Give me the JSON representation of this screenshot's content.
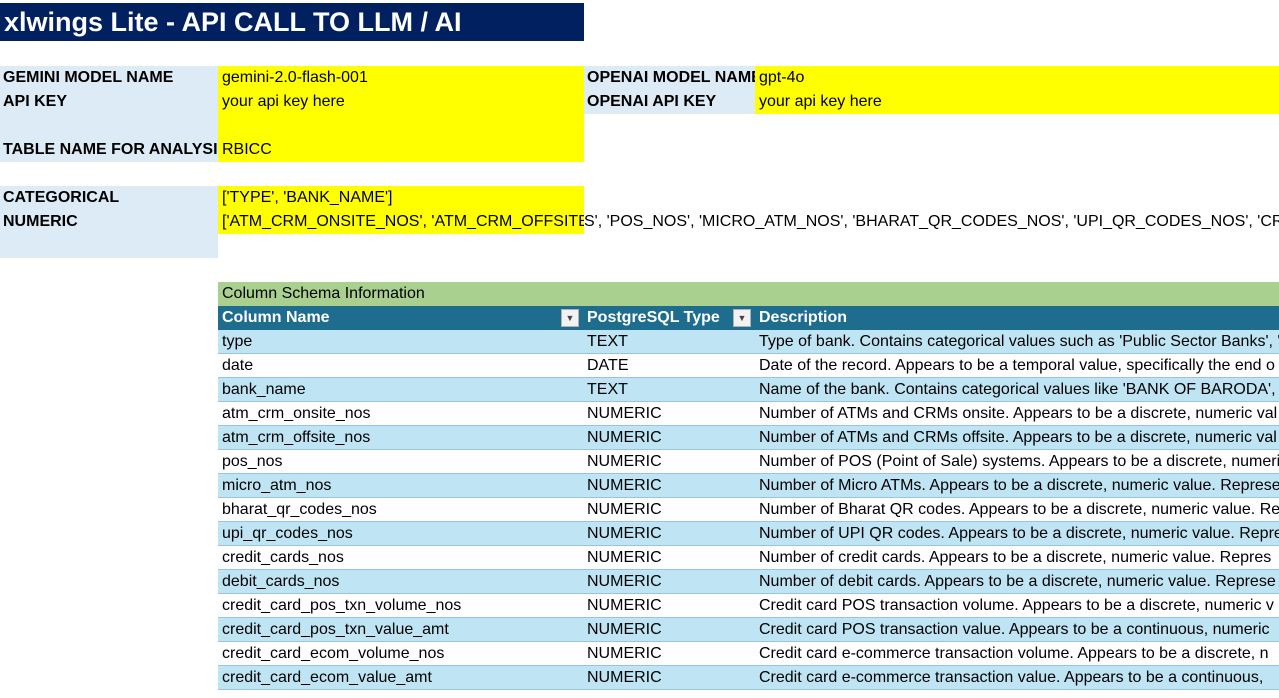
{
  "title": "xlwings Lite -  API CALL TO LLM  / AI",
  "config": {
    "gemini_model_label": "GEMINI MODEL NAME",
    "gemini_model_value": "gemini-2.0-flash-001",
    "api_key_label": "API KEY",
    "api_key_value": "your api key here",
    "openai_model_label": "OPENAI MODEL NAME",
    "openai_model_value": "gpt-4o",
    "openai_api_key_label": "OPENAI API KEY",
    "openai_api_key_value": "your api key here",
    "table_name_label": "TABLE NAME FOR ANALYSIS",
    "table_name_value": "RBICC",
    "categorical_label": "CATEGORICAL",
    "categorical_value": "['TYPE', 'BANK_NAME']",
    "numeric_label": "NUMERIC",
    "numeric_value_highlighted": "['ATM_CRM_ONSITE_NOS', 'ATM_CRM_OFFSITE_NO",
    "numeric_value_overflow": "S', 'POS_NOS', 'MICRO_ATM_NOS', 'BHARAT_QR_CODES_NOS', 'UPI_QR_CODES_NOS', 'CREDIT_C"
  },
  "schema": {
    "title": "Column Schema Information",
    "headers": [
      "Column Name",
      "PostgreSQL Type",
      "Description"
    ],
    "rows": [
      {
        "name": "type",
        "type": "TEXT",
        "desc": "Type of bank. Contains categorical values such as 'Public Sector Banks', '"
      },
      {
        "name": "date",
        "type": "DATE",
        "desc": "Date of the record. Appears to be a temporal value, specifically the end o"
      },
      {
        "name": "bank_name",
        "type": "TEXT",
        "desc": "Name of the bank. Contains categorical values like 'BANK OF BARODA', 'B"
      },
      {
        "name": "atm_crm_onsite_nos",
        "type": "NUMERIC",
        "desc": "Number of ATMs and CRMs onsite. Appears to be a discrete, numeric val"
      },
      {
        "name": "atm_crm_offsite_nos",
        "type": "NUMERIC",
        "desc": "Number of ATMs and CRMs offsite. Appears to be a discrete, numeric val"
      },
      {
        "name": "pos_nos",
        "type": "NUMERIC",
        "desc": "Number of POS (Point of Sale) systems. Appears to be a discrete, numeri"
      },
      {
        "name": "micro_atm_nos",
        "type": "NUMERIC",
        "desc": "Number of Micro ATMs. Appears to be a discrete, numeric value. Represe"
      },
      {
        "name": "bharat_qr_codes_nos",
        "type": "NUMERIC",
        "desc": "Number of Bharat QR codes. Appears to be a discrete, numeric value. Re"
      },
      {
        "name": "upi_qr_codes_nos",
        "type": "NUMERIC",
        "desc": "Number of UPI QR codes. Appears to be a discrete, numeric value. Repre"
      },
      {
        "name": "credit_cards_nos",
        "type": "NUMERIC",
        "desc": "Number of credit cards. Appears to be a discrete, numeric value. Repres"
      },
      {
        "name": "debit_cards_nos",
        "type": "NUMERIC",
        "desc": "Number of debit cards. Appears to be a discrete, numeric value. Represe"
      },
      {
        "name": "credit_card_pos_txn_volume_nos",
        "type": "NUMERIC",
        "desc": "Credit card POS transaction volume. Appears to be a discrete, numeric v"
      },
      {
        "name": "credit_card_pos_txn_value_amt",
        "type": "NUMERIC",
        "desc": "Credit card POS transaction value. Appears to be a continuous, numeric"
      },
      {
        "name": "credit_card_ecom_volume_nos",
        "type": "NUMERIC",
        "desc": "Credit card e-commerce transaction volume. Appears to be a discrete, n"
      },
      {
        "name": "credit_card_ecom_value_amt",
        "type": "NUMERIC",
        "desc": "Credit card e-commerce transaction value. Appears to be a continuous,"
      }
    ]
  },
  "colors": {
    "title_bg": "#002060",
    "label_bg": "#ddebf7",
    "input_bg": "#ffff00",
    "schema_title_bg": "#a9d08e",
    "header_bg": "#1f6d8e",
    "band_bg": "#bfe4f4"
  },
  "icons": {
    "filter": "filter-dropdown-icon"
  }
}
